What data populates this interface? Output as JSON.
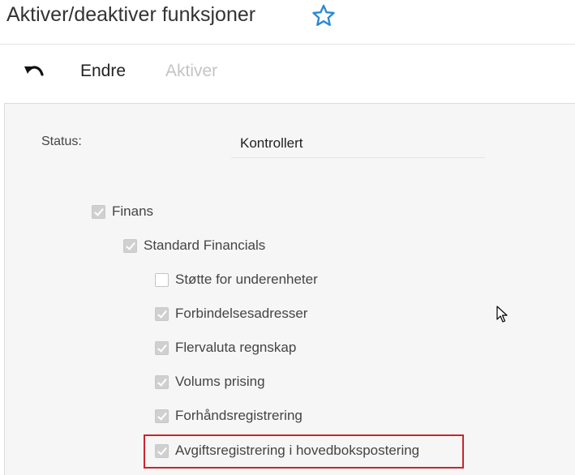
{
  "header": {
    "title": "Aktiver/deaktiver funksjoner",
    "favorite_icon": "star-icon"
  },
  "toolbar": {
    "undo_icon": "undo-icon",
    "edit_label": "Endre",
    "activate_label": "Aktiver"
  },
  "status": {
    "label": "Status:",
    "value": "Kontrollert"
  },
  "features": [
    {
      "label": "Finans",
      "checked": true,
      "level": 0
    },
    {
      "label": "Standard Financials",
      "checked": true,
      "level": 1
    },
    {
      "label": "Støtte for underenheter",
      "checked": false,
      "level": 2
    },
    {
      "label": "Forbindelsesadresser",
      "checked": true,
      "level": 2
    },
    {
      "label": "Flervaluta regnskap",
      "checked": true,
      "level": 2
    },
    {
      "label": "Volums prising",
      "checked": true,
      "level": 2
    },
    {
      "label": "Forhåndsregistrering",
      "checked": true,
      "level": 2
    },
    {
      "label": "Avgiftsregistrering i hovedbokspostering",
      "checked": true,
      "level": 2,
      "highlighted": true
    }
  ],
  "colors": {
    "highlight_border": "#c8262c",
    "favorite_star": "#2a8ad4",
    "disabled_text": "#c4c4c4"
  }
}
